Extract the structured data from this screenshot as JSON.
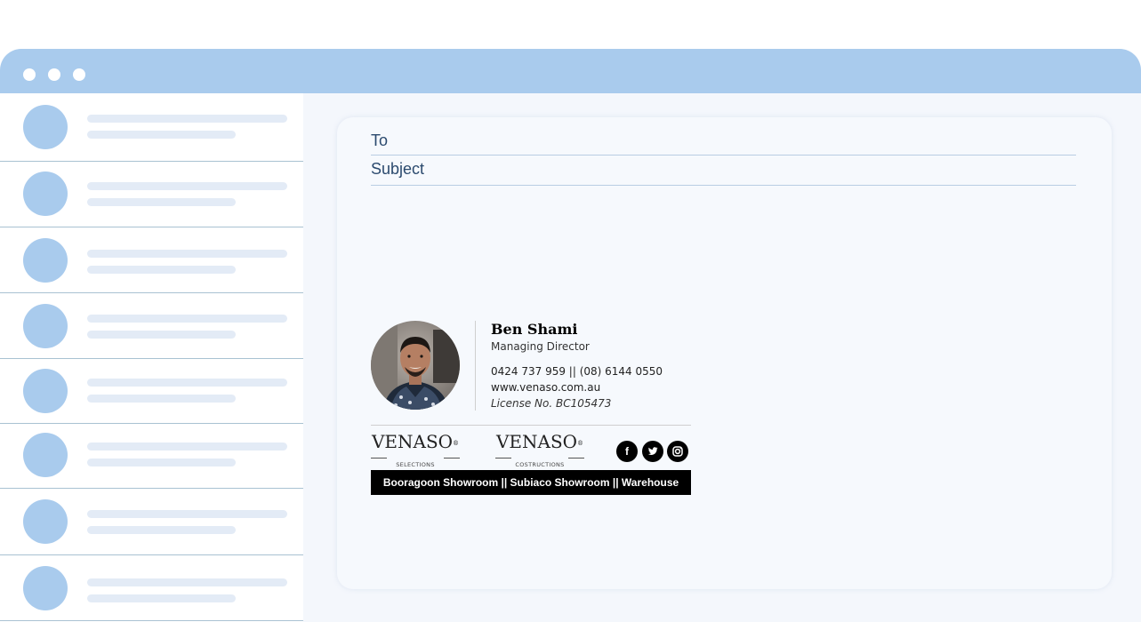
{
  "colors": {
    "titlebar": "#a9cbed",
    "window_bg": "#f4f7fc",
    "placeholder_avatar": "#a9cbed",
    "placeholder_line": "#e3ebf6",
    "field_text": "#2b4a6e",
    "banner": "#000000"
  },
  "window": {
    "controls": [
      "dot-icon",
      "dot-icon",
      "dot-icon"
    ]
  },
  "inbox": {
    "item_count": 8
  },
  "compose": {
    "to_label": "To",
    "subject_label": "Subject"
  },
  "signature": {
    "name": "Ben Shami",
    "title": "Managing Director",
    "phone": "0424 737 959 || (08) 6144 0550",
    "website": "www.venaso.com.au",
    "license": "License No. BC105473",
    "logos": [
      {
        "word": "VENASO",
        "mark": "®",
        "sub": "SELECTIONS"
      },
      {
        "word": "VENASO",
        "mark": "®",
        "sub": "COSTRUCTIONS"
      }
    ],
    "social": [
      {
        "icon": "facebook-icon",
        "glyph": "f"
      },
      {
        "icon": "twitter-icon",
        "glyph": "t"
      },
      {
        "icon": "instagram-icon",
        "glyph": "◎"
      }
    ],
    "banner_text": "Booragoon Showroom || Subiaco Showroom || Warehouse"
  }
}
